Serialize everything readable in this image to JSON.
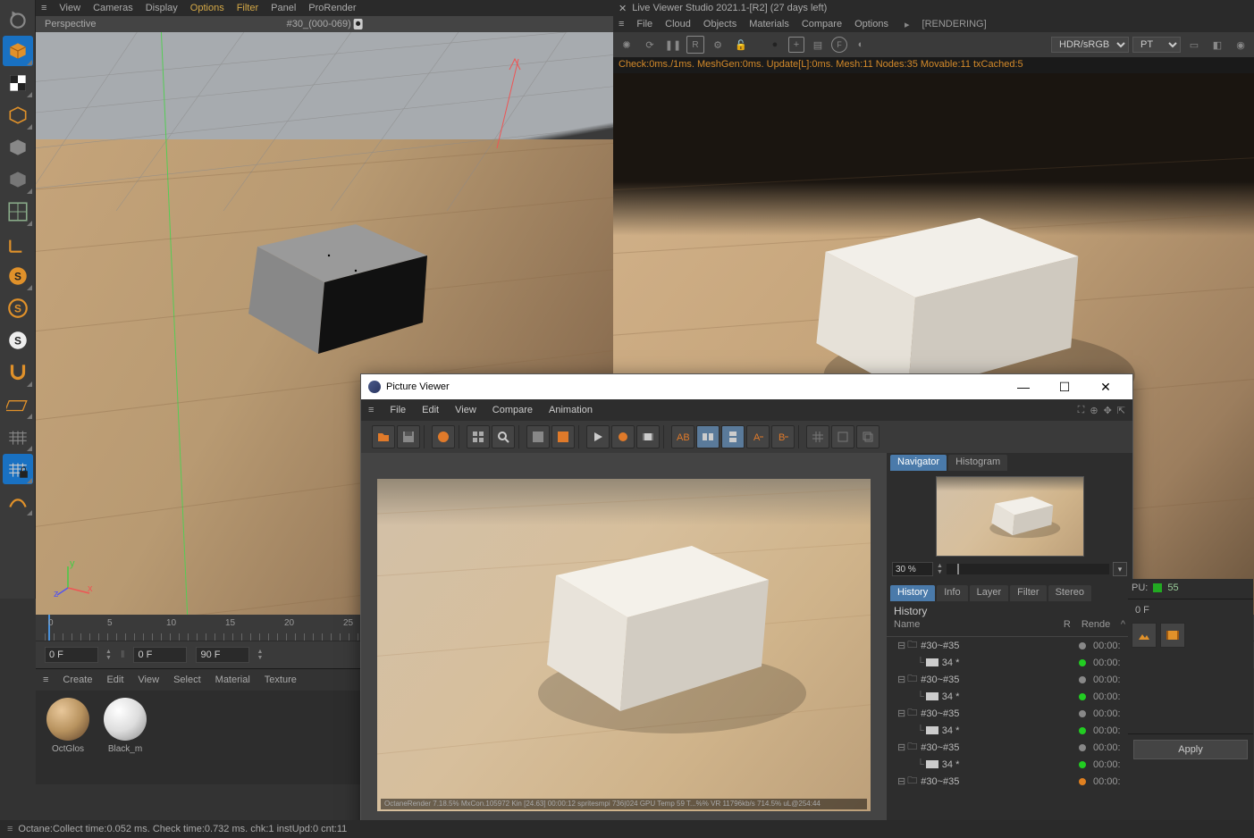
{
  "main_menu": {
    "items": [
      "View",
      "Cameras",
      "Display",
      "Options",
      "Filter",
      "Panel",
      "ProRender"
    ],
    "highlighted": [
      3,
      4
    ]
  },
  "viewport": {
    "header_label": "Perspective",
    "take_label": "#30_(000-069)"
  },
  "live_viewer": {
    "title": "Live Viewer Studio 2021.1-[R2] (27 days left)",
    "menu": [
      "File",
      "Cloud",
      "Objects",
      "Materials",
      "Compare",
      "Options"
    ],
    "status": "[RENDERING]",
    "colorspace": "HDR/sRGB",
    "mode": "PT",
    "info": "Check:0ms./1ms. MeshGen:0ms. Update[L]:0ms. Mesh:11 Nodes:35 Movable:11 txCached:5"
  },
  "timeline": {
    "marks": [
      "0",
      "5",
      "10",
      "15",
      "20",
      "25"
    ],
    "frame_cur": "0 F",
    "frame_start": "0 F",
    "frame_end": "90 F"
  },
  "materials": {
    "menu": [
      "Create",
      "Edit",
      "View",
      "Select",
      "Material",
      "Texture"
    ],
    "items": [
      {
        "name": "OctGlos"
      },
      {
        "name": "Black_m"
      }
    ]
  },
  "picture_viewer": {
    "title": "Picture Viewer",
    "menu": [
      "File",
      "Edit",
      "View",
      "Compare",
      "Animation"
    ],
    "nav_tabs": [
      "Navigator",
      "Histogram"
    ],
    "nav_active": 0,
    "zoom": "30 %",
    "tabs2": [
      "History",
      "Info",
      "Layer",
      "Filter",
      "Stereo"
    ],
    "tabs2_active": 0,
    "hist_section": "History",
    "hist_cols": [
      "Name",
      "R",
      "Rende"
    ],
    "history": [
      {
        "type": "folder",
        "name": "#30~#35",
        "dot": "gray",
        "time": "00:00:"
      },
      {
        "type": "item",
        "name": "34 *",
        "dot": "green",
        "time": "00:00:"
      },
      {
        "type": "folder",
        "name": "#30~#35",
        "dot": "gray",
        "time": "00:00:"
      },
      {
        "type": "item",
        "name": "34 *",
        "dot": "green",
        "time": "00:00:"
      },
      {
        "type": "folder",
        "name": "#30~#35",
        "dot": "gray",
        "time": "00:00:"
      },
      {
        "type": "item",
        "name": "34 *",
        "dot": "green",
        "time": "00:00:"
      },
      {
        "type": "folder",
        "name": "#30~#35",
        "dot": "gray",
        "time": "00:00:"
      },
      {
        "type": "item",
        "name": "34 *",
        "dot": "green",
        "time": "00:00:"
      },
      {
        "type": "folder",
        "name": "#30~#35",
        "dot": "orange",
        "time": "00:00:"
      }
    ],
    "watermark": "OctaneRender 7.18.5% MxCon.105972 Kin [24.63] 00:00:12 spritesmpi 736|024 GPU Temp 59 T...%% VR 11796kb/s 714.5% uL@254:44"
  },
  "right_panel": {
    "pu_label": "PU:",
    "pu_val": "55",
    "frame": "0 F",
    "apply": "Apply"
  },
  "statusbar": {
    "text": "Octane:Collect time:0.052 ms.  Check time:0.732 ms.  chk:1  instUpd:0  cnt:11"
  }
}
